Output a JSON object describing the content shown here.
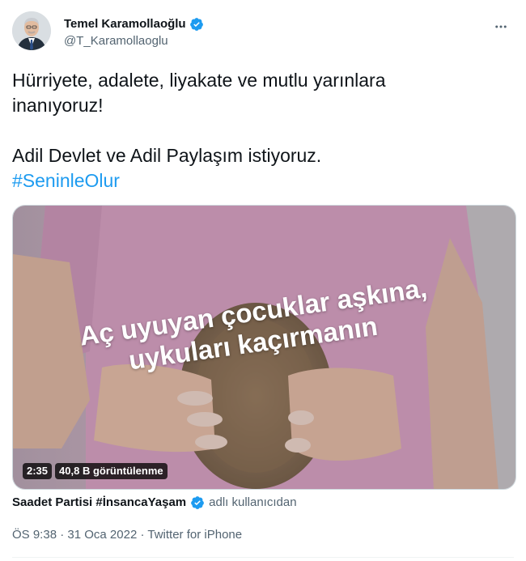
{
  "author": {
    "display_name": "Temel Karamollaoğlu",
    "handle": "@T_Karamollaoglu",
    "verified": true
  },
  "tweet": {
    "line1": "Hürriyete, adalete, liyakate ve mutlu yarınlara",
    "line2": "inanıyoruz!",
    "line3": "Adil Devlet ve Adil Paylaşım istiyoruz.",
    "hashtag": "#SeninleOlur"
  },
  "media": {
    "caption_line1": "Aç uyuyan çocuklar aşkına,",
    "caption_line2": "uykuları kaçırmanın",
    "duration": "2:35",
    "views": "40,8 B görüntülenme"
  },
  "attribution": {
    "account": "Saadet Partisi #İnsancaYaşam",
    "suffix": "adlı kullanıcıdan"
  },
  "meta": {
    "time": "ÖS 9:38",
    "separator": "·",
    "date": "31 Oca 2022",
    "source": "Twitter for iPhone"
  },
  "colors": {
    "accent": "#1d9bf0",
    "text": "#0f1419",
    "secondary": "#536471"
  },
  "icons": {
    "verified": "verified-badge-icon",
    "more": "more-options-icon"
  }
}
